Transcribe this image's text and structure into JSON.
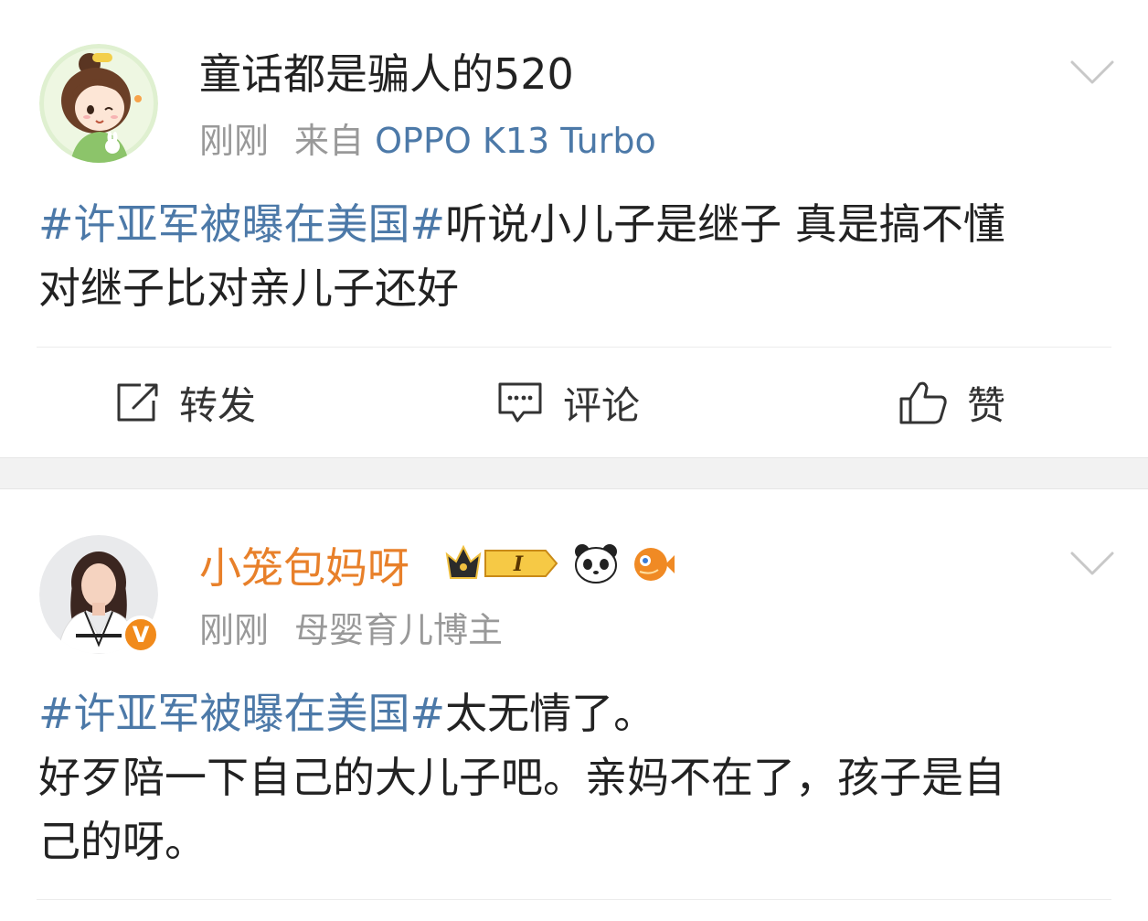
{
  "posts": [
    {
      "username": "童话都是骗人的520",
      "time": "刚刚",
      "source_prefix": "来自",
      "source": "OPPO K13 Turbo",
      "topic": "#许亚军被曝在美国#",
      "text": "听说小儿子是继子 真是搞不懂\n对继子比对亲儿子还好",
      "actions": {
        "repost": "转发",
        "comment": "评论",
        "like": "赞"
      }
    },
    {
      "username": "小笼包妈呀",
      "level_badge": "I",
      "time": "刚刚",
      "bio": "母婴育儿博主",
      "verified": "V",
      "topic": "#许亚军被曝在美国#",
      "text": "太无情了。\n好歹陪一下自己的大儿子吧。亲妈不在了，孩子是自\n己的呀。"
    }
  ],
  "colors": {
    "topic": "#4c79a8",
    "vip_name": "#e8802a",
    "meta": "#999999",
    "verified_badge": "#f18a1b",
    "separator_bg": "#f2f2f2"
  },
  "icons": {
    "repost": "repost-icon",
    "comment": "comment-icon",
    "like": "thumbs-up-icon",
    "more": "chevron-down-icon",
    "crown": "crown-level-badge-icon",
    "panda": "panda-icon",
    "fish": "pufferfish-icon"
  }
}
